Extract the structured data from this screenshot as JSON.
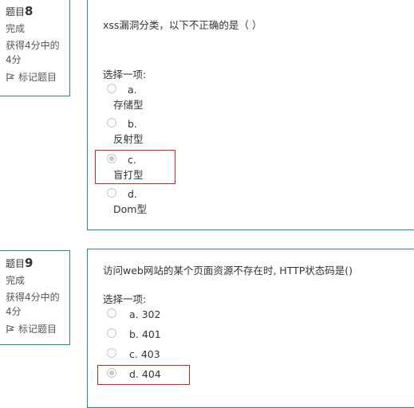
{
  "q8": {
    "label": "题目",
    "num": "8",
    "status": "完成",
    "score": "获得4分中的4分",
    "flag_label": "标记题目",
    "text": "xss漏洞分类，以下不正确的是（  ）",
    "prompt": "选择一项:",
    "options": [
      {
        "letter": "a.",
        "value": "存储型",
        "selected": false
      },
      {
        "letter": "b.",
        "value": "反射型",
        "selected": false
      },
      {
        "letter": "c.",
        "value": "盲打型",
        "selected": true
      },
      {
        "letter": "d.",
        "value": "Dom型",
        "selected": false
      }
    ]
  },
  "q9": {
    "label": "题目",
    "num": "9",
    "status": "完成",
    "score": "获得4分中的4分",
    "flag_label": "标记题目",
    "text": "访问web网站的某个页面资源不存在时, HTTP状态码是()",
    "prompt": "选择一项:",
    "options": [
      {
        "text": "a. 302",
        "selected": false
      },
      {
        "text": "b. 401",
        "selected": false
      },
      {
        "text": "c. 403",
        "selected": false
      },
      {
        "text": "d. 404",
        "selected": true
      }
    ]
  },
  "colors": {
    "border": "#1f8a8c",
    "highlight": "#dd2222"
  },
  "icons": {
    "flag": "flag-icon",
    "radio": "radio-icon"
  }
}
